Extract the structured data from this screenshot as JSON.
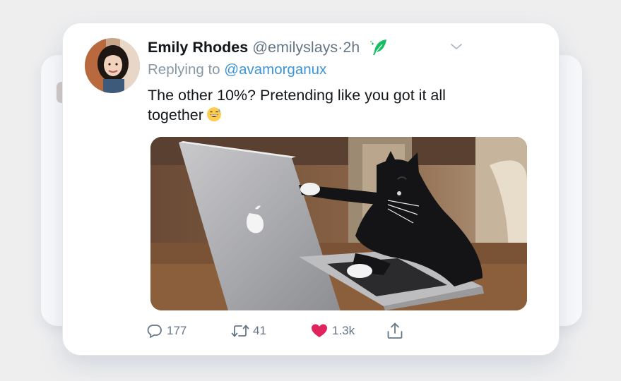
{
  "tweet": {
    "display_name": "Emily Rhodes",
    "handle": "@emilyslays",
    "time": "·2h",
    "replying_prefix": "Replying to",
    "replying_to": "@avamorganux",
    "text": "The other 10%? Pretending like you got it all together"
  },
  "actions": {
    "reply_count": "177",
    "retweet_count": "41",
    "like_count": "1.3k"
  },
  "icons": {
    "quill": "feather-quill-icon",
    "chevron": "chevron-down-icon",
    "reply": "reply-icon",
    "retweet": "retweet-icon",
    "like": "heart-icon",
    "share": "share-icon",
    "emoji": "grinning-sweat-emoji"
  },
  "colors": {
    "name": "#14171a",
    "secondary": "#657786",
    "mention": "#3b94d9",
    "quill": "#17bf63",
    "like": "#e0245e"
  }
}
